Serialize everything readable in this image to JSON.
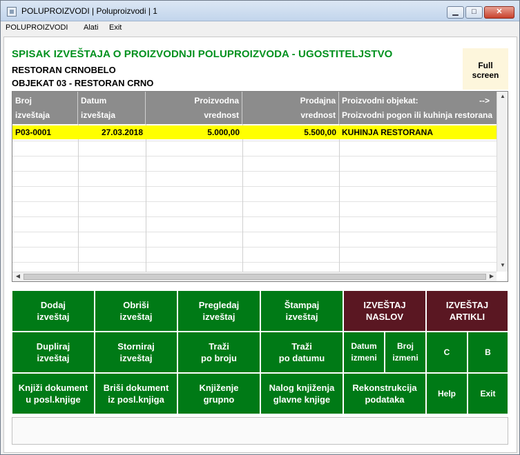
{
  "window": {
    "title": "POLUPROIZVODI | Poluproizvodi | 1",
    "min_glyph": "▁",
    "max_glyph": "□",
    "close_glyph": "✕"
  },
  "menu": [
    "POLUPROIZVODI",
    "Alati",
    "Exit"
  ],
  "header": {
    "title": "SPISAK IZVEŠTAJA O PROIZVODNJI POLUPROIZVODA - UGOSTITELJSTVO",
    "restaurant": "RESTORAN CRNOBELO",
    "object": "OBJEKAT  03 - RESTORAN CRNO",
    "fullscreen_line1": "Full",
    "fullscreen_line2": "screen"
  },
  "table": {
    "columns": [
      {
        "line1": "Broj",
        "line2": "izveštaja"
      },
      {
        "line1": "Datum",
        "line2": "izveštaja"
      },
      {
        "line1": "Proizvodna",
        "line2": "vrednost"
      },
      {
        "line1": "Prodajna",
        "line2": "vrednost"
      },
      {
        "line1": "Proizvodni objekat:",
        "arrow": "-->",
        "line2": "Proizvodni pogon ili kuhinja restorana"
      }
    ],
    "rows": [
      {
        "broj": "P03-0001",
        "datum": "27.03.2018",
        "proizvodna": "5.000,00",
        "prodajna": "5.500,00",
        "objekat": "KUHINJA RESTORANA"
      }
    ]
  },
  "buttons": {
    "dodaj": {
      "line1": "Dodaj",
      "line2": "izveštaj"
    },
    "obrisi": {
      "line1": "Obriši",
      "line2": "izveštaj"
    },
    "pregledaj": {
      "line1": "Pregledaj",
      "line2": "izveštaj"
    },
    "stampaj": {
      "line1": "Štampaj",
      "line2": "izveštaj"
    },
    "izvestaj_naslov": {
      "line1": "IZVEŠTAJ",
      "line2": "NASLOV"
    },
    "izvestaj_artikli": {
      "line1": "IZVEŠTAJ",
      "line2": "ARTIKLI"
    },
    "dupliraj": {
      "line1": "Dupliraj",
      "line2": "izveštaj"
    },
    "storniraj": {
      "line1": "Storniraj",
      "line2": "izveštaj"
    },
    "trazi_broj": {
      "line1": "Traži",
      "line2": "po broju"
    },
    "trazi_datum": {
      "line1": "Traži",
      "line2": "po datumu"
    },
    "datum_izmeni": {
      "line1": "Datum",
      "line2": "izmeni"
    },
    "broj_izmeni": {
      "line1": "Broj",
      "line2": "izmeni"
    },
    "c": "C",
    "b": "B",
    "knjizi": {
      "line1": "Knjiži dokument",
      "line2": "u posl.knjige"
    },
    "brisi": {
      "line1": "Briši dokument",
      "line2": "iz posl.knjiga"
    },
    "knjizenje": {
      "line1": "Knjiženje",
      "line2": "grupno"
    },
    "nalog": {
      "line1": "Nalog knjiženja",
      "line2": "glavne knjige"
    },
    "rekonstrukcija": {
      "line1": "Rekonstrukcija",
      "line2": "podataka"
    },
    "help": "Help",
    "exit": "Exit"
  },
  "colors": {
    "title_green": "#00911e",
    "button_green": "#007a16",
    "button_maroon": "#5a1722",
    "row_highlight": "#ffff00",
    "header_gray": "#8c8c8c"
  }
}
